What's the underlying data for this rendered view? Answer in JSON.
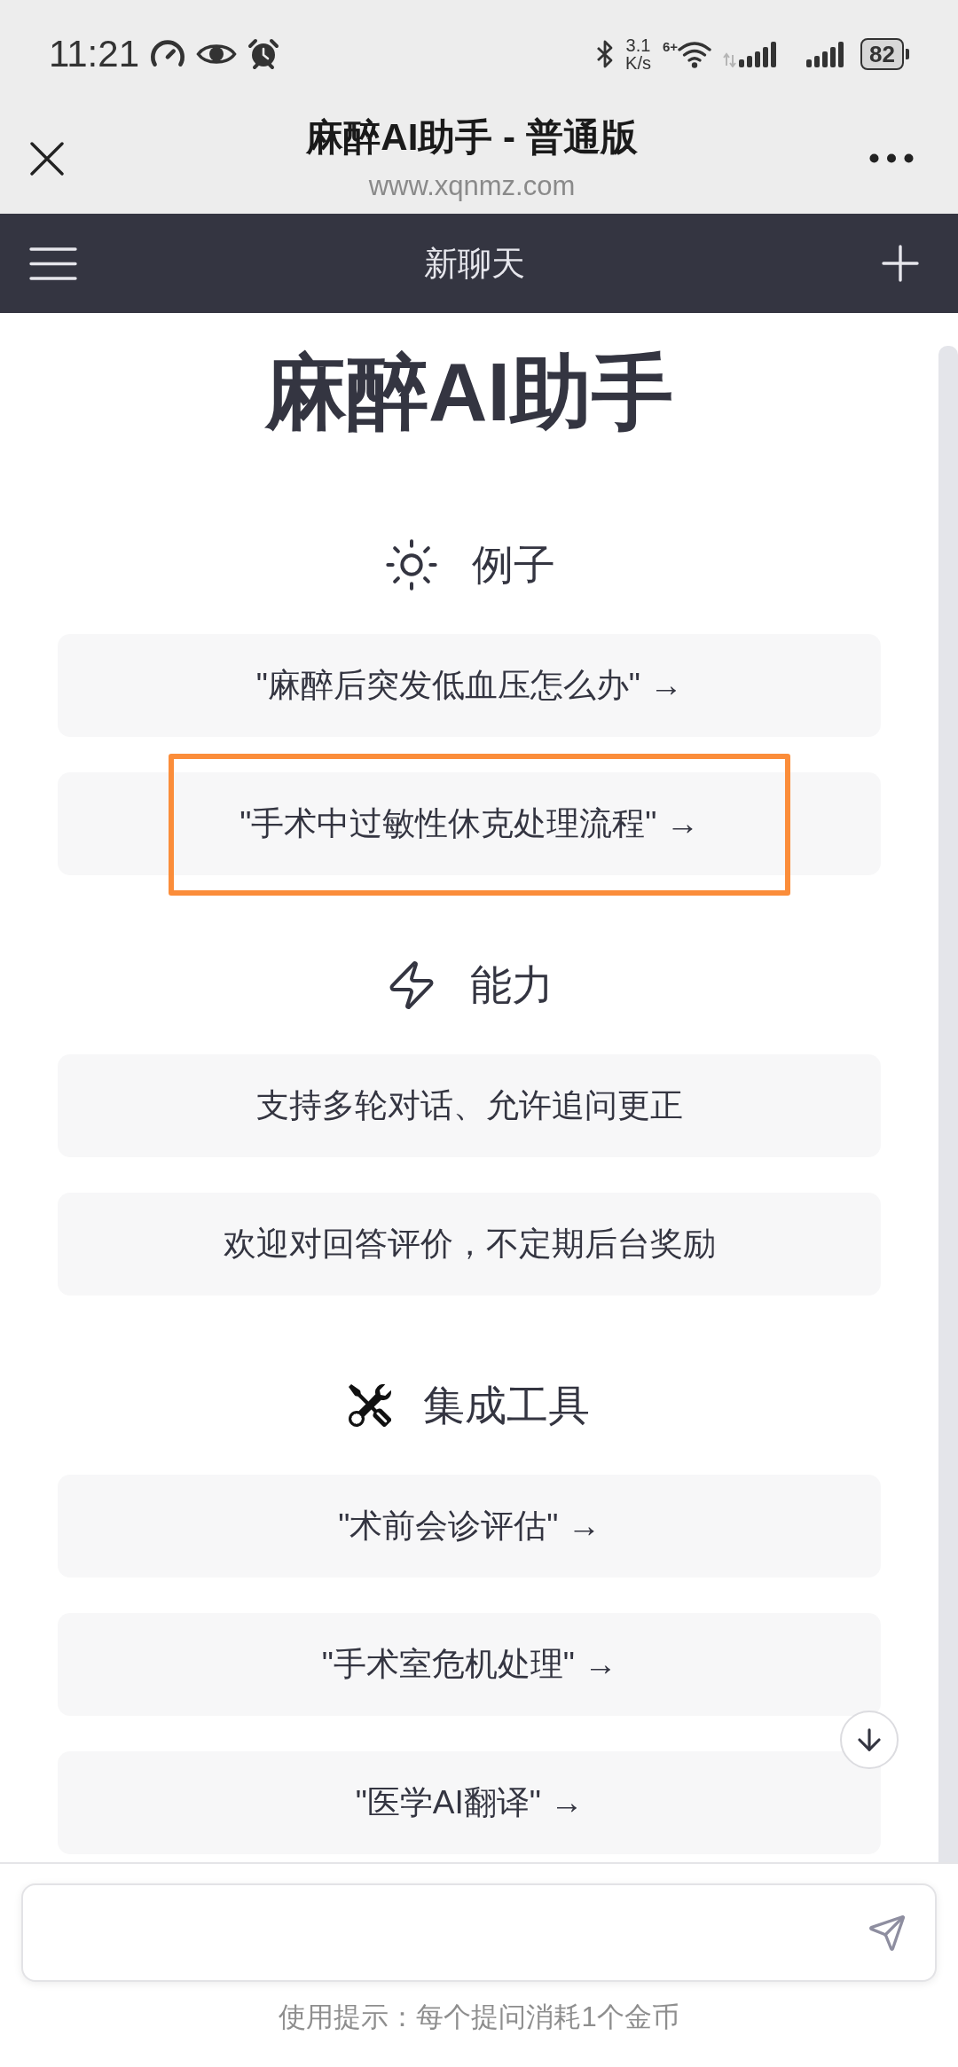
{
  "status_bar": {
    "time": "11:21",
    "speed_value": "3.1",
    "speed_unit": "K/s",
    "wifi_label": "6+",
    "battery": "82"
  },
  "title_bar": {
    "title": "麻醉AI助手 - 普通版",
    "url": "www.xqnmz.com"
  },
  "nav_bar": {
    "title": "新聊天"
  },
  "heading": "麻醉AI助手",
  "sections": [
    {
      "kind": "examples",
      "title": "例子",
      "items": [
        {
          "text": "\"麻醉后突发低血压怎么办\" →",
          "highlighted": false
        },
        {
          "text": "\"手术中过敏性休克处理流程\" →",
          "highlighted": true
        }
      ]
    },
    {
      "kind": "capabilities",
      "title": "能力",
      "items": [
        {
          "text": "支持多轮对话、允许追问更正",
          "highlighted": false
        },
        {
          "text": "欢迎对回答评价，不定期后台奖励",
          "highlighted": false
        }
      ]
    },
    {
      "kind": "tools",
      "title": "集成工具",
      "items": [
        {
          "text": "\"术前会诊评估\" →",
          "highlighted": false
        },
        {
          "text": "\"手术室危机处理\" →",
          "highlighted": false
        },
        {
          "text": "\"医学AI翻译\" →",
          "highlighted": false
        }
      ]
    }
  ],
  "composer": {
    "hint": "使用提示：每个提问消耗1个金币"
  }
}
